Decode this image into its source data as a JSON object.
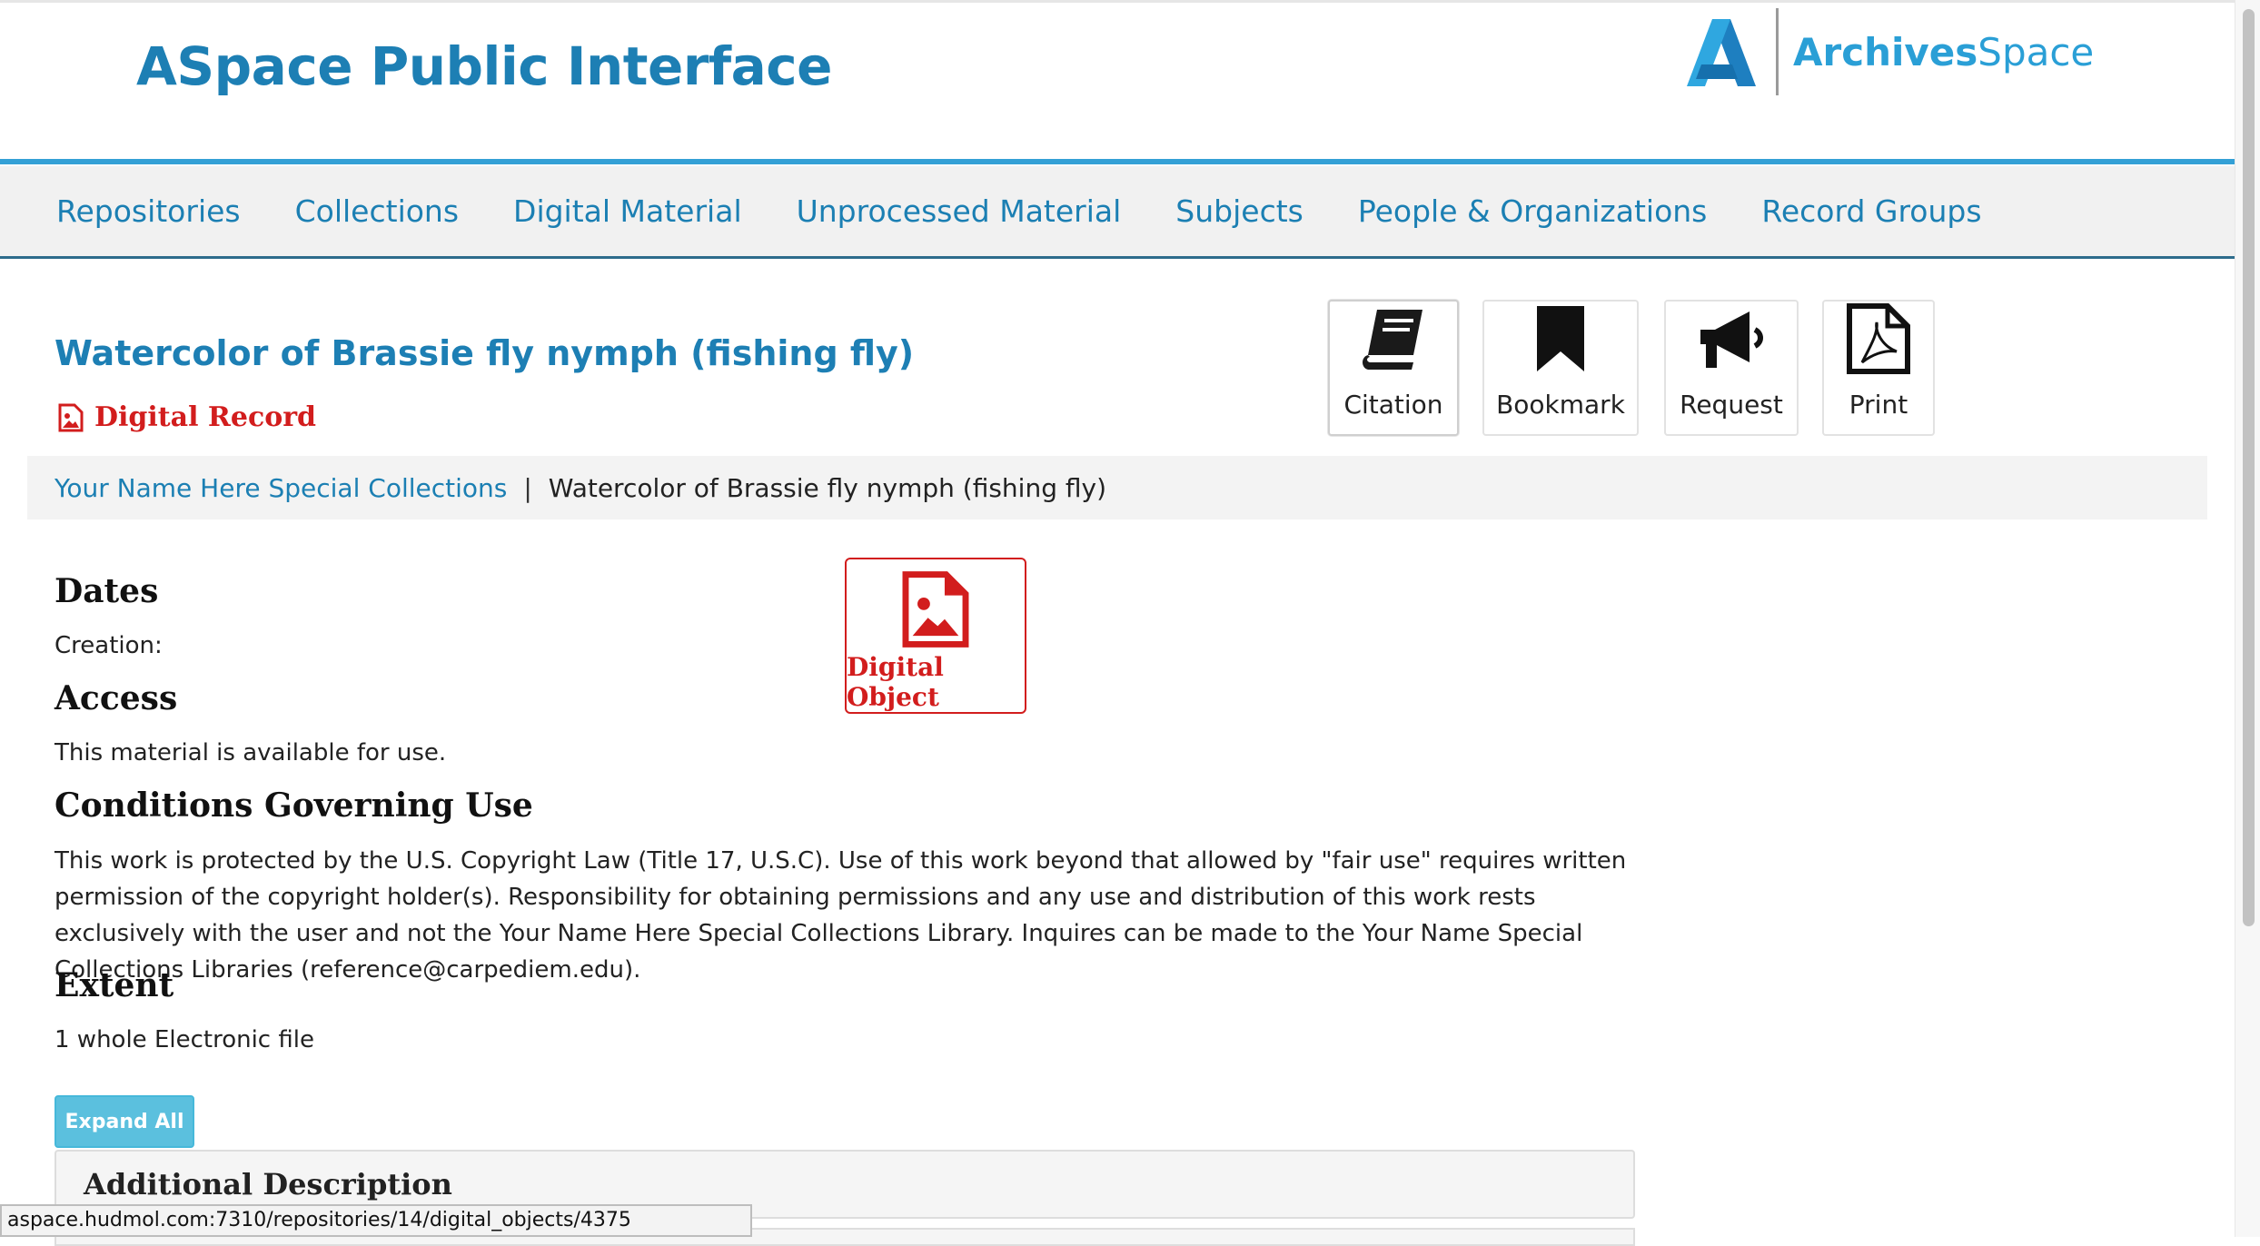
{
  "header": {
    "site_title": "ASpace Public Interface",
    "brand_bold": "Archives",
    "brand_light": "Space"
  },
  "nav": {
    "items": [
      {
        "label": "Repositories"
      },
      {
        "label": "Collections"
      },
      {
        "label": "Digital Material"
      },
      {
        "label": "Unprocessed Material"
      },
      {
        "label": "Subjects"
      },
      {
        "label": "People & Organizations"
      },
      {
        "label": "Record Groups"
      }
    ]
  },
  "record": {
    "title": "Watercolor of Brassie fly nymph (fishing fly)",
    "type_label": "Digital Record",
    "type_icon": "file-image-icon"
  },
  "actions": {
    "citation": "Citation",
    "bookmark": "Bookmark",
    "request": "Request",
    "print": "Print"
  },
  "breadcrumb": {
    "repository": "Your Name Here Special Collections",
    "separator": "|",
    "current": "Watercolor of Brassie fly nymph (fishing fly)"
  },
  "sections": {
    "dates_heading": "Dates",
    "dates_creation": "Creation:",
    "access_heading": "Access",
    "access_text": "This material is available for use.",
    "use_heading": "Conditions Governing Use",
    "use_text": "This work is protected by the U.S. Copyright Law (Title 17, U.S.C). Use of this work beyond that allowed by \"fair use\" requires written permission of the copyright holder(s). Responsibility for obtaining permissions and any use and distribution of this work rests exclusively with the user and not the Your Name Here Special Collections Library. Inquires can be made to the Your Name Special Collections Libraries (reference@carpediem.edu).",
    "extent_heading": "Extent",
    "extent_text": "1 whole Electronic file"
  },
  "digital_object": {
    "label": "Digital Object"
  },
  "expand_all_label": "Expand All",
  "additional_description_title": "Additional Description",
  "status_url": "aspace.hudmol.com:7310/repositories/14/digital_objects/4375",
  "colors": {
    "link_blue": "#1b7fb3",
    "accent_red": "#d21d1d",
    "header_rule": "#34a0d6",
    "expand_button": "#5bc0de"
  }
}
